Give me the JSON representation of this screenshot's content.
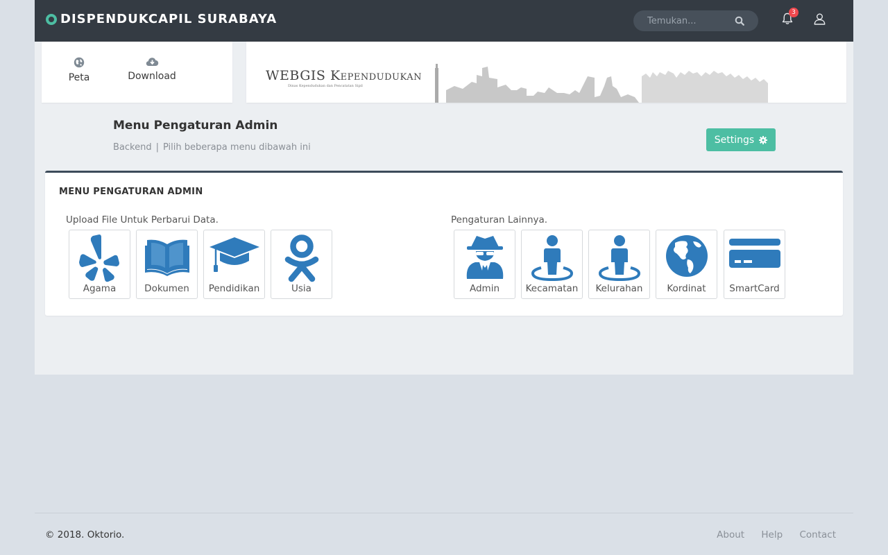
{
  "brand": {
    "title": "DISPENDUKCAPIL SURABAYA"
  },
  "search": {
    "placeholder": "Temukan..."
  },
  "notifications": {
    "count": "3"
  },
  "quick_links": [
    {
      "label": "Peta",
      "icon": "globe-icon"
    },
    {
      "label": "Download",
      "icon": "cloud-download-icon"
    }
  ],
  "banner": {
    "title": "WEBGIS Kependudukan",
    "subtitle": "Dinas Kependudukan dan Pencatatan Sipil"
  },
  "header": {
    "title": "Menu Pengaturan Admin",
    "crumb_section": "Backend",
    "crumb_text": "Pilih beberapa menu dibawah ini",
    "settings_label": "Settings"
  },
  "panel": {
    "title": "MENU PENGATURAN ADMIN",
    "upload_label": "Upload File Untuk Perbarui Data.",
    "other_label": "Pengaturan Lainnya.",
    "upload_tiles": [
      {
        "label": "Agama",
        "icon": "yelp-icon"
      },
      {
        "label": "Dokumen",
        "icon": "book-icon"
      },
      {
        "label": "Pendidikan",
        "icon": "graduation-cap-icon"
      },
      {
        "label": "Usia",
        "icon": "person-icon"
      }
    ],
    "other_tiles": [
      {
        "label": "Admin",
        "icon": "user-secret-icon"
      },
      {
        "label": "Kecamatan",
        "icon": "street-view-icon"
      },
      {
        "label": "Kelurahan",
        "icon": "street-view-icon"
      },
      {
        "label": "Kordinat",
        "icon": "globe-americas-icon"
      },
      {
        "label": "SmartCard",
        "icon": "credit-card-icon"
      }
    ]
  },
  "footer": {
    "copyright": "© 2018. Oktorio.",
    "links": [
      "About",
      "Help",
      "Contact"
    ]
  },
  "colors": {
    "accent": "#4dbea3",
    "navbar": "#343b43",
    "icon_blue": "#2f7bbb",
    "badge": "#f0484e"
  }
}
